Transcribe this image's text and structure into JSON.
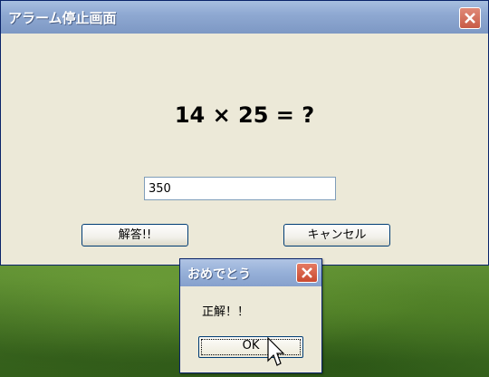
{
  "main_window": {
    "title": "アラーム停止画面",
    "question": "14 × 25 = ?",
    "answer_value": "350",
    "answer_button": "解答!!",
    "cancel_button": "キャンセル"
  },
  "popup": {
    "title": "おめでとう",
    "message": "正解！！",
    "ok_button": "OK"
  },
  "colors": {
    "titlebar": "#8fa9d2",
    "window_bg": "#ece9d8",
    "close_red": "#c85a46"
  },
  "icons": [
    "close-icon",
    "mouse-cursor-icon"
  ]
}
